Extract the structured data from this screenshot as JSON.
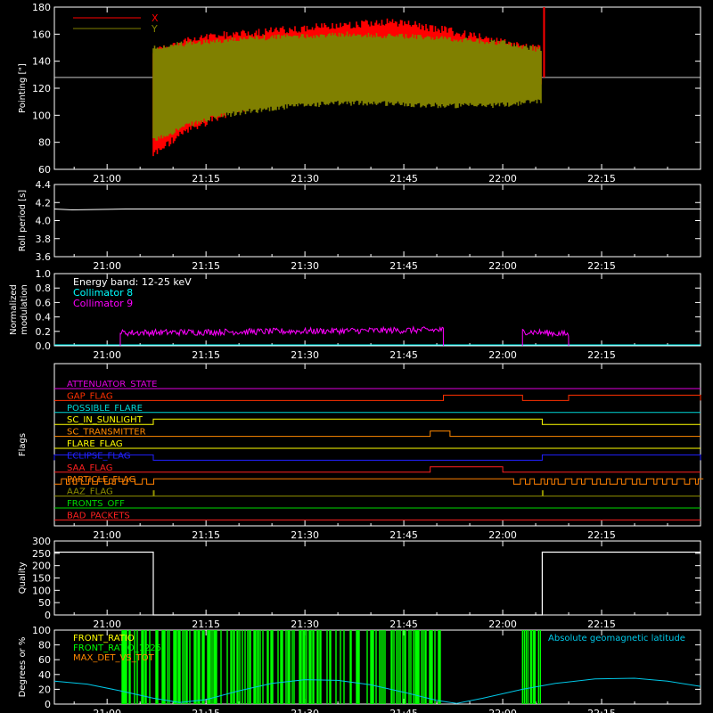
{
  "chart_data": [
    {
      "type": "line",
      "ylabel": "Pointing [\"]",
      "ylim": [
        60,
        180
      ],
      "yticks": [
        "60",
        "80",
        "100",
        "120",
        "140",
        "160",
        "180"
      ],
      "xticks": [
        "21:00",
        "21:15",
        "21:30",
        "21:45",
        "22:00",
        "22:15"
      ],
      "series": [
        {
          "name": "X",
          "color": "#ff0000",
          "data_start": "21:07",
          "data_end": "22:06",
          "upper_envelope": [
            150,
            158,
            162,
            164,
            166,
            168,
            170,
            172,
            170,
            166,
            161,
            156,
            152
          ],
          "lower_envelope": [
            68,
            85,
            96,
            104,
            109,
            114,
            117,
            119,
            120,
            121,
            121,
            120,
            118
          ]
        },
        {
          "name": "Y",
          "color": "#808000",
          "data_start": "21:07",
          "data_end": "22:06",
          "upper_envelope": [
            152,
            155,
            157,
            159,
            160,
            161,
            162,
            161,
            160,
            159,
            157,
            155,
            150
          ],
          "lower_envelope": [
            79,
            90,
            97,
            101,
            104,
            106,
            107,
            107,
            106,
            105,
            105,
            106,
            109
          ]
        }
      ],
      "reference_level": 128
    },
    {
      "type": "line",
      "ylabel": "Roll period [s]",
      "ylim": [
        3.5,
        4.5
      ],
      "yticks": [
        "3.6",
        "3.8",
        "4.0",
        "4.2",
        "4.4"
      ],
      "xticks": [
        "21:00",
        "21:15",
        "21:30",
        "21:45",
        "22:00",
        "22:15"
      ],
      "series": [
        {
          "name": "",
          "color": "#ffffff",
          "value": 4.16
        }
      ]
    },
    {
      "type": "line",
      "ylabel": "Normalized modulation",
      "ylim": [
        0,
        1
      ],
      "yticks": [
        "0.0",
        "0.2",
        "0.4",
        "0.6",
        "0.8",
        "1.0"
      ],
      "xticks": [
        "21:00",
        "21:15",
        "21:30",
        "21:45",
        "22:00",
        "22:15"
      ],
      "legend": [
        "Energy band: 12-25 keV",
        "Collimator 8",
        "Collimator 9"
      ],
      "series": [
        {
          "name": "Collimator 8",
          "color": "#00ffff",
          "value": 0.0
        },
        {
          "name": "Collimator 9",
          "color": "#ff00ff",
          "segments": [
            {
              "start": "21:02",
              "end": "21:51",
              "level_start": 0.18,
              "level_end": 0.22
            },
            {
              "start": "22:03",
              "end": "22:10",
              "level_start": 0.2,
              "level_end": 0.16
            }
          ]
        }
      ]
    },
    {
      "type": "line",
      "ylabel": "Flags",
      "xticks": [
        "21:00",
        "21:15",
        "21:30",
        "21:45",
        "22:00",
        "22:15"
      ],
      "flags": [
        {
          "name": "ATTENUATOR_STATE",
          "color": "#e000e0",
          "high": []
        },
        {
          "name": "GAP_FLAG",
          "color": "#ff3000",
          "high": [
            [
              "21:51",
              "22:03"
            ],
            [
              "22:10",
              "22:30"
            ]
          ]
        },
        {
          "name": "POSSIBLE_FLARE",
          "color": "#00d8d8",
          "high": []
        },
        {
          "name": "SC_IN_SUNLIGHT",
          "color": "#ffff00",
          "high": [
            [
              "21:07",
              "22:06"
            ]
          ]
        },
        {
          "name": "SC_TRANSMITTER",
          "color": "#ff8800",
          "high": [
            [
              "21:49",
              "21:52"
            ]
          ]
        },
        {
          "name": "FLARE_FLAG",
          "color": "#ffff00",
          "high": []
        },
        {
          "name": "ECLIPSE_FLAG",
          "color": "#2020ff",
          "high": [
            [
              "20:52",
              "21:07"
            ],
            [
              "22:06",
              "22:30"
            ]
          ]
        },
        {
          "name": "SAA_FLAG",
          "color": "#ff2020",
          "high": [
            [
              "21:49",
              "22:00"
            ]
          ]
        },
        {
          "name": "PARTICLE_FLAG",
          "color": "#ff8000",
          "high": [
            [
              "20:52",
              "21:07"
            ],
            [
              "22:01",
              "22:30"
            ]
          ]
        },
        {
          "name": "AAZ_FLAG",
          "color": "#909000",
          "high": [
            [
              "21:07",
              "21:07"
            ],
            [
              "22:06",
              "22:06"
            ]
          ]
        },
        {
          "name": "FRONTS_OFF",
          "color": "#00d800",
          "high": []
        },
        {
          "name": "BAD_PACKETS",
          "color": "#ff2020",
          "high": []
        }
      ]
    },
    {
      "type": "line",
      "ylabel": "Quality",
      "ylim": [
        0,
        300
      ],
      "yticks": [
        "0",
        "50",
        "100",
        "150",
        "200",
        "250",
        "300"
      ],
      "xticks": [
        "21:00",
        "21:15",
        "21:30",
        "21:45",
        "22:00",
        "22:15"
      ],
      "series": [
        {
          "name": "",
          "color": "#ffffff",
          "points": [
            [
              "20:52",
              255
            ],
            [
              "21:07",
              255
            ],
            [
              "21:07",
              0
            ],
            [
              "22:06",
              0
            ],
            [
              "22:06",
              255
            ],
            [
              "22:30",
              255
            ]
          ]
        }
      ]
    },
    {
      "type": "line",
      "ylabel": "Degrees or %",
      "ylim": [
        0,
        100
      ],
      "yticks": [
        "0",
        "20",
        "40",
        "60",
        "80",
        "100"
      ],
      "xticks": [
        "21:00",
        "21:15",
        "21:30",
        "21:45",
        "22:00",
        "22:15"
      ],
      "legend": [
        "FRONT_RATIO",
        "FRONT_RATIO_1225",
        "MAX_DET_VS_TOT",
        "Absolute geomagnetic latitude"
      ],
      "series": [
        {
          "name": "FRONT_RATIO",
          "color": "#ffff00"
        },
        {
          "name": "FRONT_RATIO_1225",
          "color": "#00ff00",
          "spikes_range": [
            "21:02",
            "21:51"
          ],
          "spikes_range_2": [
            "22:03",
            "22:06"
          ]
        },
        {
          "name": "MAX_DET_VS_TOT",
          "color": "#ff8800"
        },
        {
          "name": "Absolute geomagnetic latitude",
          "color": "#00c8e8",
          "points": [
            [
              "20:52",
              31
            ],
            [
              "20:57",
              27
            ],
            [
              "21:02",
              18
            ],
            [
              "21:07",
              8
            ],
            [
              "21:11",
              2
            ],
            [
              "21:15",
              6
            ],
            [
              "21:20",
              18
            ],
            [
              "21:25",
              28
            ],
            [
              "21:30",
              33
            ],
            [
              "21:35",
              32
            ],
            [
              "21:40",
              26
            ],
            [
              "21:45",
              16
            ],
            [
              "21:50",
              5
            ],
            [
              "21:53",
              1
            ],
            [
              "21:57",
              8
            ],
            [
              "22:03",
              20
            ],
            [
              "22:08",
              28
            ],
            [
              "22:14",
              34
            ],
            [
              "22:20",
              35
            ],
            [
              "22:25",
              31
            ],
            [
              "22:30",
              24
            ]
          ]
        }
      ]
    }
  ]
}
